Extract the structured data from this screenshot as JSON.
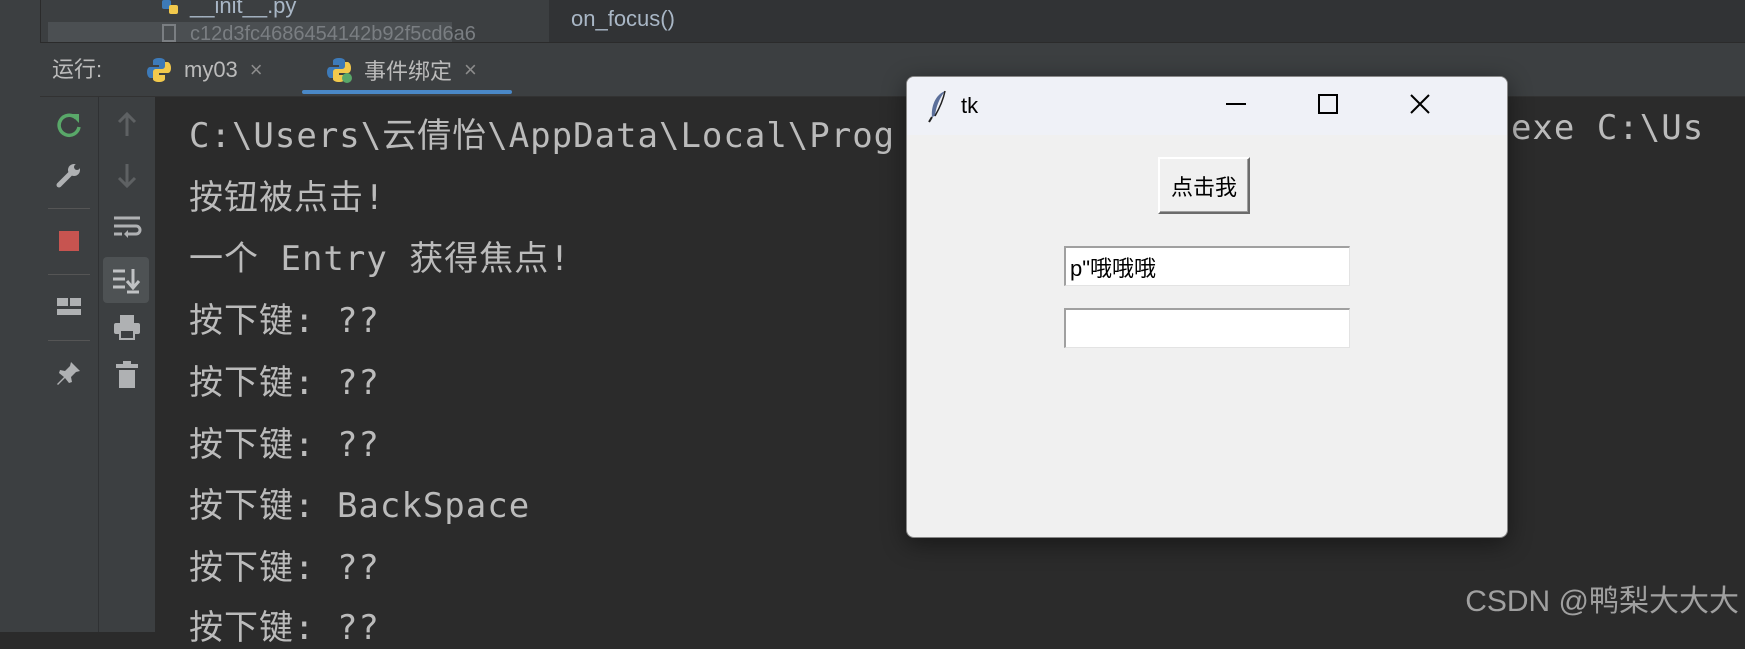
{
  "file_tree": {
    "item_1": "__init__.py",
    "item_2": "c12d3fc4686454142b92f5cd6a6"
  },
  "structure": {
    "item": "on_focus()"
  },
  "run_panel": {
    "label": "运行:",
    "tabs": [
      {
        "label": "my03",
        "close": "×"
      },
      {
        "label": "事件绑定",
        "close": "×"
      }
    ]
  },
  "console": {
    "lines": [
      "C:\\Users\\云倩怡\\AppData\\Local\\Prog",
      "按钮被点击!",
      "一个 Entry 获得焦点!",
      "按下键: ??",
      "按下键: ??",
      "按下键: ??",
      "按下键: BackSpace",
      "按下键: ??",
      "按下键: ??"
    ],
    "line_1_tail": "n.exe C:\\Us"
  },
  "tk_window": {
    "title": "tk",
    "button_label": "点击我",
    "entry_1_value": "p\"哦哦哦",
    "entry_2_value": ""
  },
  "watermark": "CSDN @鸭梨大大大",
  "colors": {
    "console_bg": "#2b2b2b",
    "panel_bg": "#3c3f41",
    "console_text": "#bbbbbb",
    "rerun_green": "#59a869",
    "stop_red": "#c75450",
    "tab_underline": "#4a88c7"
  }
}
